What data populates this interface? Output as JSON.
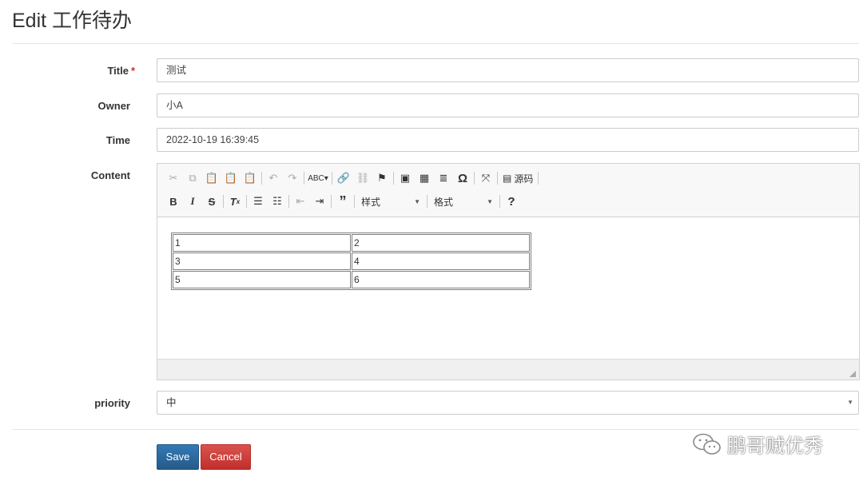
{
  "page": {
    "title": "Edit 工作待办"
  },
  "form": {
    "title_label": "Title",
    "required_mark": "*",
    "title_value": "测试",
    "owner_label": "Owner",
    "owner_value": "小A",
    "time_label": "Time",
    "time_value": "2022-10-19 16:39:45",
    "content_label": "Content",
    "priority_label": "priority",
    "priority_value": "中"
  },
  "editor": {
    "source_label": "源码",
    "styles_label": "样式",
    "format_label": "格式",
    "table": [
      [
        "1",
        "2"
      ],
      [
        "3",
        "4"
      ],
      [
        "5",
        "6"
      ]
    ]
  },
  "actions": {
    "save": "Save",
    "cancel": "Cancel"
  },
  "watermark": {
    "text": "鹏哥贼优秀"
  },
  "colors": {
    "primary": "#337ab7",
    "danger": "#d9534f",
    "required": "#c9302c"
  }
}
